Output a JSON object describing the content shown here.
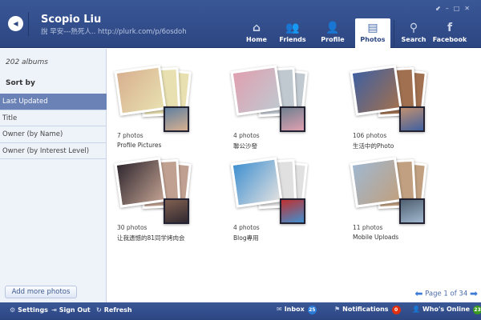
{
  "header": {
    "name": "Scopio Liu",
    "status": "說 早安---熱死人.. http://plurk.com/p/6osdoh",
    "nav": [
      {
        "label": "Home",
        "icon": "home-icon",
        "glyph": "⌂"
      },
      {
        "label": "Friends",
        "icon": "friends-icon",
        "glyph": "👥"
      },
      {
        "label": "Profile",
        "icon": "profile-icon",
        "glyph": "👤"
      },
      {
        "label": "Photos",
        "icon": "photos-icon",
        "glyph": "▤"
      },
      {
        "label": "Search",
        "icon": "search-icon",
        "glyph": "⚲"
      },
      {
        "label": "Facebook",
        "icon": "facebook-icon",
        "glyph": "f"
      }
    ],
    "active": "Photos"
  },
  "sidebar": {
    "count": "202 albums",
    "sort_by": "Sort by",
    "sorts": [
      "Last Updated",
      "Title",
      "Owner (by Name)",
      "Owner (by Interest Level)"
    ],
    "selected": "Last Updated",
    "add_button": "Add more photos"
  },
  "albums": [
    {
      "count": "7 photos",
      "title": "Profile Pictures",
      "colors": [
        "#d8b090",
        "#e8e0b0",
        "#6080a0"
      ]
    },
    {
      "count": "4 photos",
      "title": "聯公沙發",
      "colors": [
        "#e0a0b0",
        "#c0c8d0",
        "#708090"
      ]
    },
    {
      "count": "106 photos",
      "title": "生活中的Photo",
      "colors": [
        "#4060a0",
        "#a07050",
        "#c09070"
      ]
    },
    {
      "count": "30 photos",
      "title": "让我遗憾的81同学烤肉会",
      "colors": [
        "#302830",
        "#c0a090",
        "#806050"
      ]
    },
    {
      "count": "4 photos",
      "title": "Blog專用",
      "colors": [
        "#4090d0",
        "#e0e0e0",
        "#c03030"
      ]
    },
    {
      "count": "11 photos",
      "title": "Mobile Uploads",
      "colors": [
        "#a0b8d0",
        "#c0a080",
        "#506070"
      ]
    }
  ],
  "pager": {
    "label": "Page 1 of 34"
  },
  "footer": {
    "settings": "Settings",
    "sign_out": "Sign Out",
    "refresh": "Refresh",
    "inbox": "Inbox",
    "inbox_count": "25",
    "notifications": "Notifications",
    "notifications_count": "0",
    "online": "Who's Online",
    "online_count": "23"
  },
  "colors": {
    "header": "#2c4682",
    "selected_sort": "#6a82b6",
    "inbox_badge": "#2a7ad8",
    "notif_badge": "#e03010",
    "online_badge": "#3a9a20"
  }
}
